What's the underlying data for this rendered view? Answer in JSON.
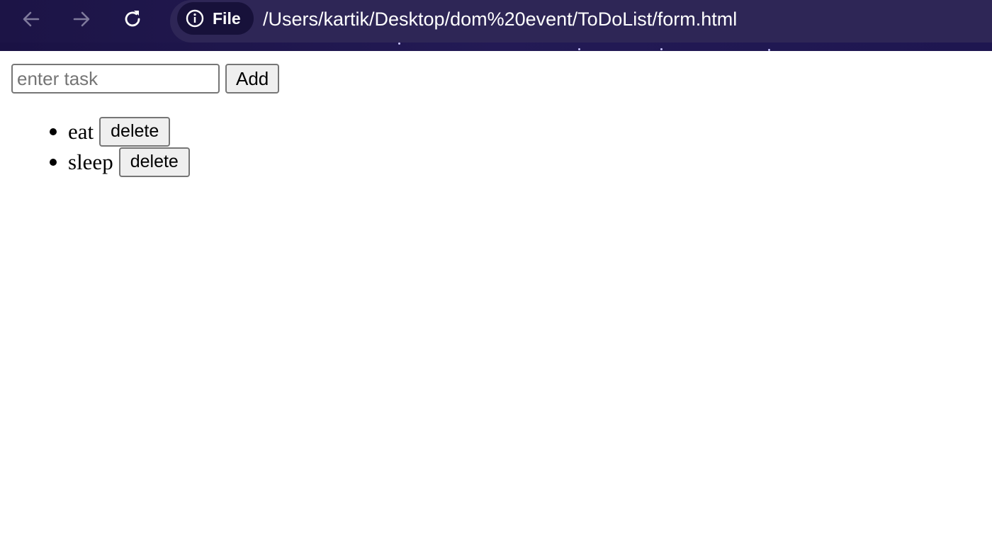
{
  "browser": {
    "back_icon": "arrow-left-icon",
    "forward_icon": "arrow-right-icon",
    "reload_icon": "reload-icon",
    "site_info_icon": "info-icon",
    "scheme_label": "File",
    "url": "/Users/kartik/Desktop/dom%20event/ToDoList/form.html"
  },
  "form": {
    "input_value": "",
    "input_placeholder": "enter task",
    "add_label": "Add"
  },
  "tasks": [
    {
      "text": "eat",
      "delete_label": "delete"
    },
    {
      "text": "sleep",
      "delete_label": "delete"
    }
  ],
  "colors": {
    "toolbar_bg": "#231a52",
    "url_chip_bg": "#17113a",
    "button_bg": "#efefef",
    "button_border": "#767676"
  }
}
